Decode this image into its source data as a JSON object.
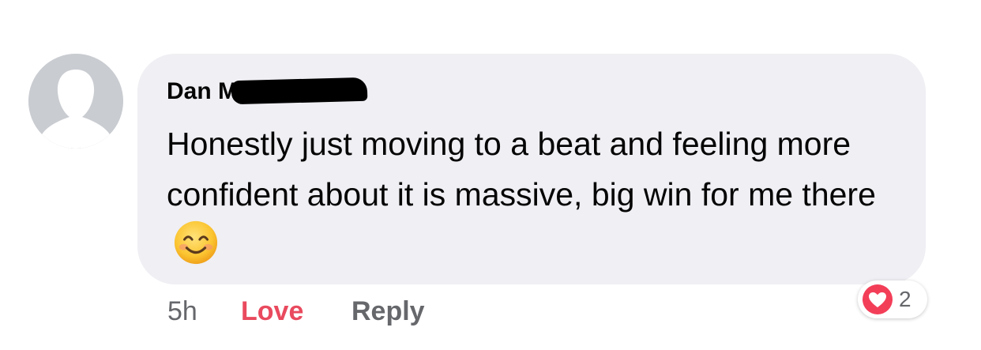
{
  "comment": {
    "author": "Dan M",
    "text": "Honestly just moving to a beat and feeling more confident about it is massive, big win for me there",
    "emoji": "smiling-face-with-smiling-eyes"
  },
  "actions": {
    "timestamp": "5h",
    "love_label": "Love",
    "reply_label": "Reply"
  },
  "reactions": {
    "type": "love",
    "count": "2"
  },
  "colors": {
    "bubble": "#efeff4",
    "love_active": "#e94a5e",
    "heart_badge": "#f33e58",
    "secondary_text": "#65676b",
    "avatar_placeholder": "#c9ccd1"
  }
}
